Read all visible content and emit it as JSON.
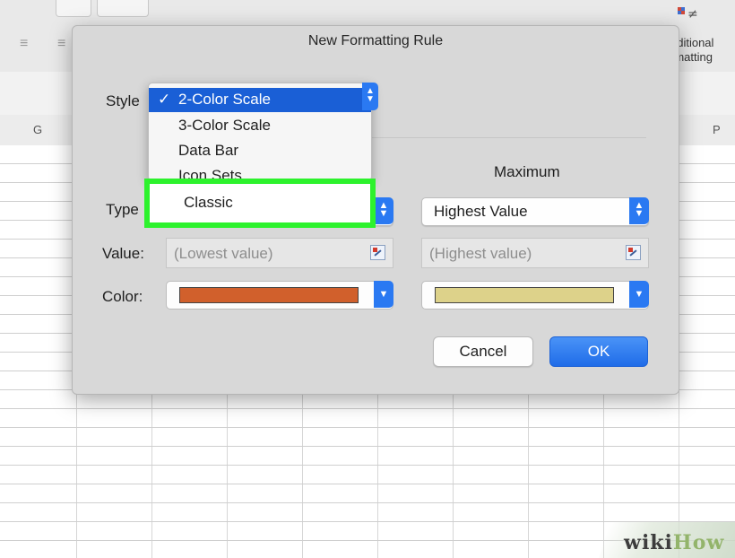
{
  "window": {
    "title": "New Formatting Rule"
  },
  "background": {
    "cf_label": "nditional\nrmatting",
    "columns": [
      "G",
      "P"
    ],
    "align_icons": [
      "align-left-icon",
      "align-center-icon"
    ]
  },
  "dialog": {
    "style_label": "Style",
    "style_menu": {
      "items": [
        {
          "label": "2-Color Scale",
          "selected": true
        },
        {
          "label": "3-Color Scale",
          "selected": false
        },
        {
          "label": "Data Bar",
          "selected": false
        },
        {
          "label": "Icon Sets",
          "selected": false
        }
      ],
      "checkmark": "✓",
      "highlighted_option": "Classic"
    },
    "maximum_header": "Maximum",
    "type_label": "Type",
    "value_label": "Value:",
    "color_label": "Color:",
    "min": {
      "value_placeholder": "(Lowest value)",
      "color": "#d1602c"
    },
    "max": {
      "type": "Highest Value",
      "value_placeholder": "(Highest value)",
      "color": "#ddd28a"
    },
    "cancel_label": "Cancel",
    "ok_label": "OK"
  },
  "colors": {
    "accent": "#2a79f2",
    "highlight": "#2df22d"
  },
  "watermark": {
    "wiki": "wiki",
    "how": "How"
  }
}
